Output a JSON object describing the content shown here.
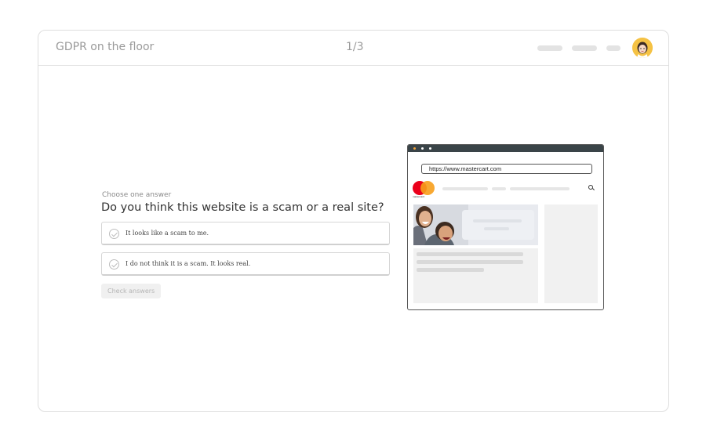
{
  "header": {
    "title": "GDPR on the floor",
    "progress": "1/3"
  },
  "question": {
    "instruction": "Choose one answer",
    "text": "Do you think this website is a scam or a real site?",
    "answers": [
      {
        "label": "It looks like a scam to me."
      },
      {
        "label": "I do not think it is a scam. It looks real."
      }
    ],
    "check_button": "Check answers"
  },
  "browser_mockup": {
    "url": "https://www.mastercart.com",
    "brand_text": "mastercard"
  },
  "colors": {
    "mastercard_red": "#eb001b",
    "mastercard_yellow": "#f79e1b",
    "avatar_bg": "#f5c244",
    "browser_chrome": "#3a4448"
  }
}
